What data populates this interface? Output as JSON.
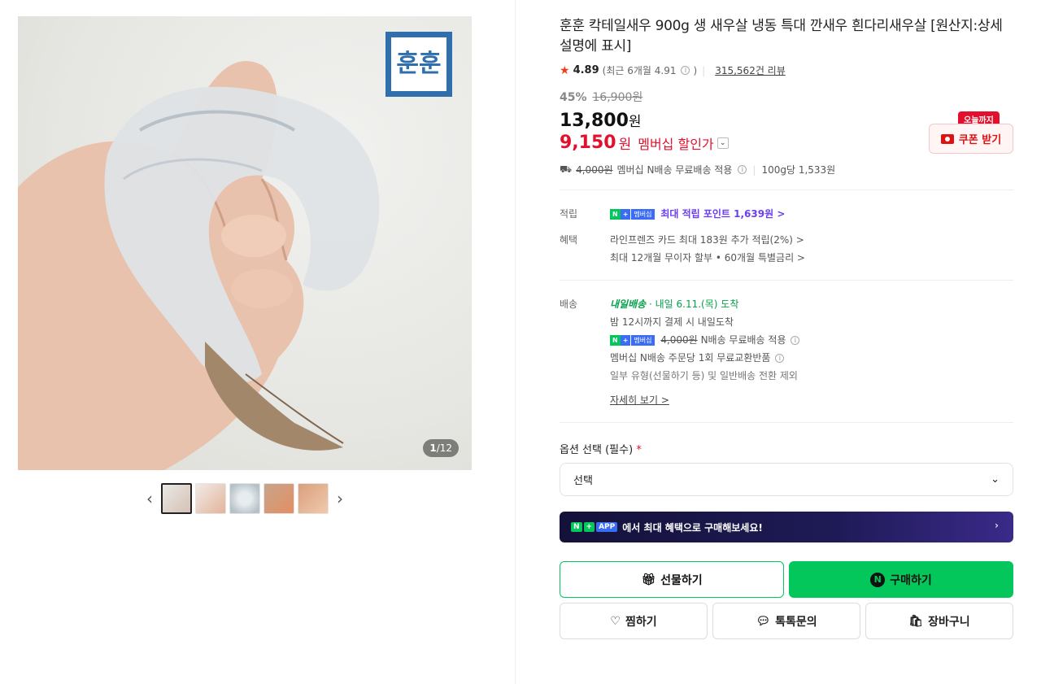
{
  "gallery": {
    "counter_current": "1",
    "counter_total": "/12",
    "logo_text": "훈훈",
    "prev_label": "‹",
    "next_label": "›"
  },
  "product": {
    "title": "훈훈 칵테일새우 900g 생 새우살 냉동 특대 깐새우 흰다리새우살 [원산지:상세설명에 표시]",
    "rating": "4.89",
    "recent_rating": "(최근 6개월 4.91",
    "review_count": "315,562건 리뷰",
    "discount": "45%",
    "original_price": "16,900원",
    "price": "13,800",
    "price_unit": "원",
    "member_price": "9,150",
    "member_unit": "원",
    "member_label": "멤버십 할인가",
    "shipping_fee": "4,000원",
    "shipping_text": "멤버십 N배송 무료배송 적용",
    "unit_price": "100g당 1,533원"
  },
  "coupon": {
    "badge": "오늘까지",
    "label": "쿠폰 받기"
  },
  "benefits": {
    "points_label": "적립",
    "points_text": "최대 적립 포인트 1,639원 >",
    "benefit_label": "혜택",
    "benefit_line1": "라인프렌즈 카드 최대 183원 추가 적립(2%) >",
    "benefit_line2": "최대 12개월 무이자 할부 • 60개월 특별금리 >"
  },
  "delivery": {
    "label": "배송",
    "tomorrow_tag": "내일배송",
    "arrival": "· 내일 6.11.(목) 도착",
    "line1": "밤 12시까지 결제 시 내일도착",
    "fee_strike": "4,000원",
    "fee_text": "N배송 무료배송 적용",
    "line3": "멤버십 N배송 주문당 1회 무료교환반품",
    "line4": "일부 유형(선물하기 등) 및 일반배송 전환 제외",
    "more": "자세히 보기 >"
  },
  "npay_tags": {
    "n": "N",
    "plus": "+",
    "member": "멤버십"
  },
  "options": {
    "label": "옵션 선택 (필수)",
    "required_mark": "*",
    "select_value": "선택"
  },
  "app_banner": {
    "tag_n": "N",
    "tag_plus": "+",
    "tag_app": "APP",
    "text": "에서 최대 혜택으로 구매해보세요!"
  },
  "buttons": {
    "gift": "선물하기",
    "buy": "구매하기",
    "wish": "찜하기",
    "talk": "톡톡문의",
    "cart": "장바구니"
  },
  "colors": {
    "naver_green": "#03c75a",
    "discount_red": "#e3102d",
    "points_purple": "#6a3ff2"
  }
}
